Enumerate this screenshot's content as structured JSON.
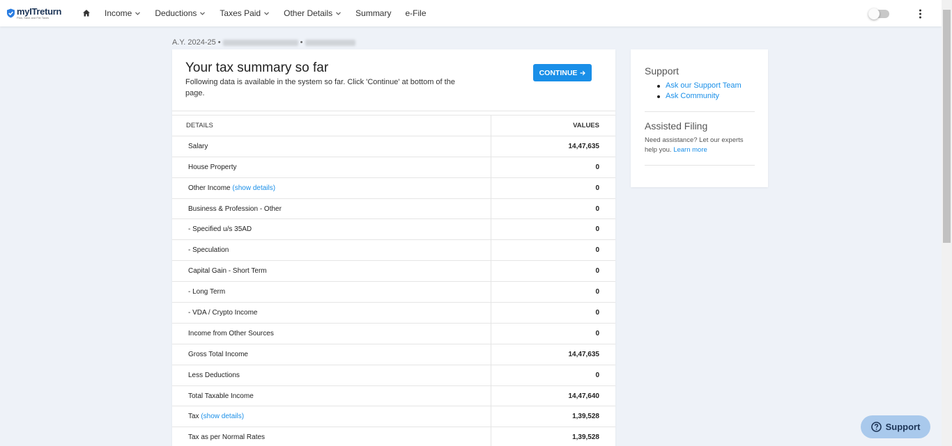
{
  "logo": {
    "name": "myITreturn",
    "tagline": "Plan, Save and File Taxes"
  },
  "nav": {
    "items": [
      {
        "label": "Income",
        "has_dropdown": true
      },
      {
        "label": "Deductions",
        "has_dropdown": true
      },
      {
        "label": "Taxes Paid",
        "has_dropdown": true
      },
      {
        "label": "Other Details",
        "has_dropdown": true
      },
      {
        "label": "Summary",
        "has_dropdown": false
      },
      {
        "label": "e-File",
        "has_dropdown": false
      }
    ]
  },
  "breadcrumb": {
    "assessment_year": "A.Y. 2024-25",
    "separator": "•"
  },
  "summary": {
    "title": "Your tax summary so far",
    "description": "Following data is available in the system so far. Click 'Continue' at bottom of the page.",
    "continue_label": "CONTINUE",
    "table": {
      "headers": {
        "details": "DETAILS",
        "values": "VALUES"
      },
      "rows": [
        {
          "label": "Salary",
          "link": "",
          "value": "14,47,635"
        },
        {
          "label": "House Property",
          "link": "",
          "value": "0"
        },
        {
          "label": "Other Income",
          "link": "(show details)",
          "value": "0"
        },
        {
          "label": "Business & Profession - Other",
          "link": "",
          "value": "0"
        },
        {
          "label": "- Specified u/s 35AD",
          "link": "",
          "value": "0"
        },
        {
          "label": "- Speculation",
          "link": "",
          "value": "0"
        },
        {
          "label": "Capital Gain - Short Term",
          "link": "",
          "value": "0"
        },
        {
          "label": "- Long Term",
          "link": "",
          "value": "0"
        },
        {
          "label": "- VDA / Crypto Income",
          "link": "",
          "value": "0"
        },
        {
          "label": "Income from Other Sources",
          "link": "",
          "value": "0"
        },
        {
          "label": "Gross Total Income",
          "link": "",
          "value": "14,47,635"
        },
        {
          "label": "Less Deductions",
          "link": "",
          "value": "0"
        },
        {
          "label": "Total Taxable Income",
          "link": "",
          "value": "14,47,640"
        },
        {
          "label": "Tax",
          "link": "(show details)",
          "value": "1,39,528"
        },
        {
          "label": "Tax as per Normal Rates",
          "link": "",
          "value": "1,39,528"
        }
      ]
    }
  },
  "sidebar": {
    "support": {
      "title": "Support",
      "links": [
        "Ask our Support Team",
        "Ask Community"
      ]
    },
    "assisted_filing": {
      "title": "Assisted Filing",
      "text": "Need assistance? Let our experts help you.",
      "link": "Learn more"
    }
  },
  "support_button": {
    "label": "Support"
  },
  "colors": {
    "accent": "#1a8fe8",
    "brand": "#1d3557",
    "support_bg": "#a9c9ec"
  }
}
